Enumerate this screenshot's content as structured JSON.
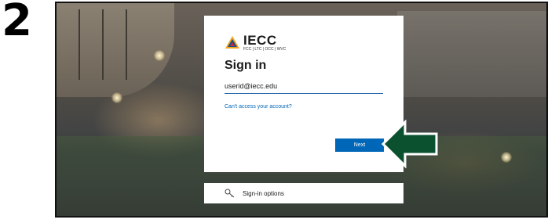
{
  "step": {
    "number": "2"
  },
  "card": {
    "logo": {
      "name": "IECC",
      "sub": "FCC | LTC | OCC | WVC"
    },
    "title": "Sign in",
    "email_value": "userid@iecc.edu",
    "cant_access": "Can't access your account?",
    "next": "Next"
  },
  "options": {
    "label": "Sign-in options",
    "icon": "key-icon"
  },
  "colors": {
    "accent": "#0067b8",
    "arrow_fill": "#0b5130",
    "arrow_outline": "#ffffff"
  }
}
